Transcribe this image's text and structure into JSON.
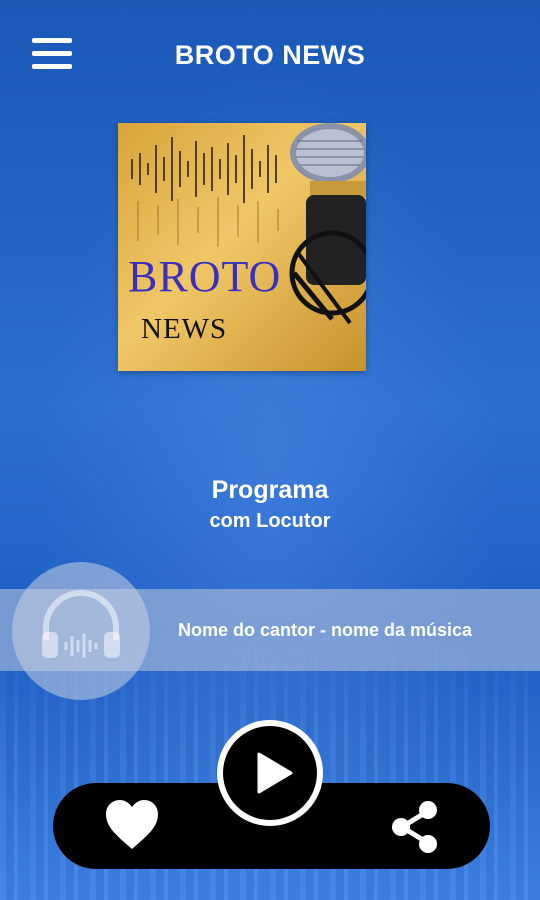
{
  "header": {
    "title": "BROTO NEWS",
    "menu_icon": "hamburger-menu-icon"
  },
  "cover": {
    "line1": "BROTO",
    "line2": "NEWS",
    "image": "microphone-with-soundwave-artwork"
  },
  "program": {
    "title": "Programa",
    "host": "com Locutor"
  },
  "now_playing": {
    "icon": "headphones-icon",
    "track": "Nome do cantor - nome da música"
  },
  "controls": {
    "favorite_icon": "heart-icon",
    "play_icon": "play-icon",
    "share_icon": "share-icon"
  },
  "colors": {
    "background": "#2a6fd0",
    "cover_gold": "#f0c767",
    "cover_text_blue": "#3b2fbe",
    "control_bar": "#000000"
  }
}
